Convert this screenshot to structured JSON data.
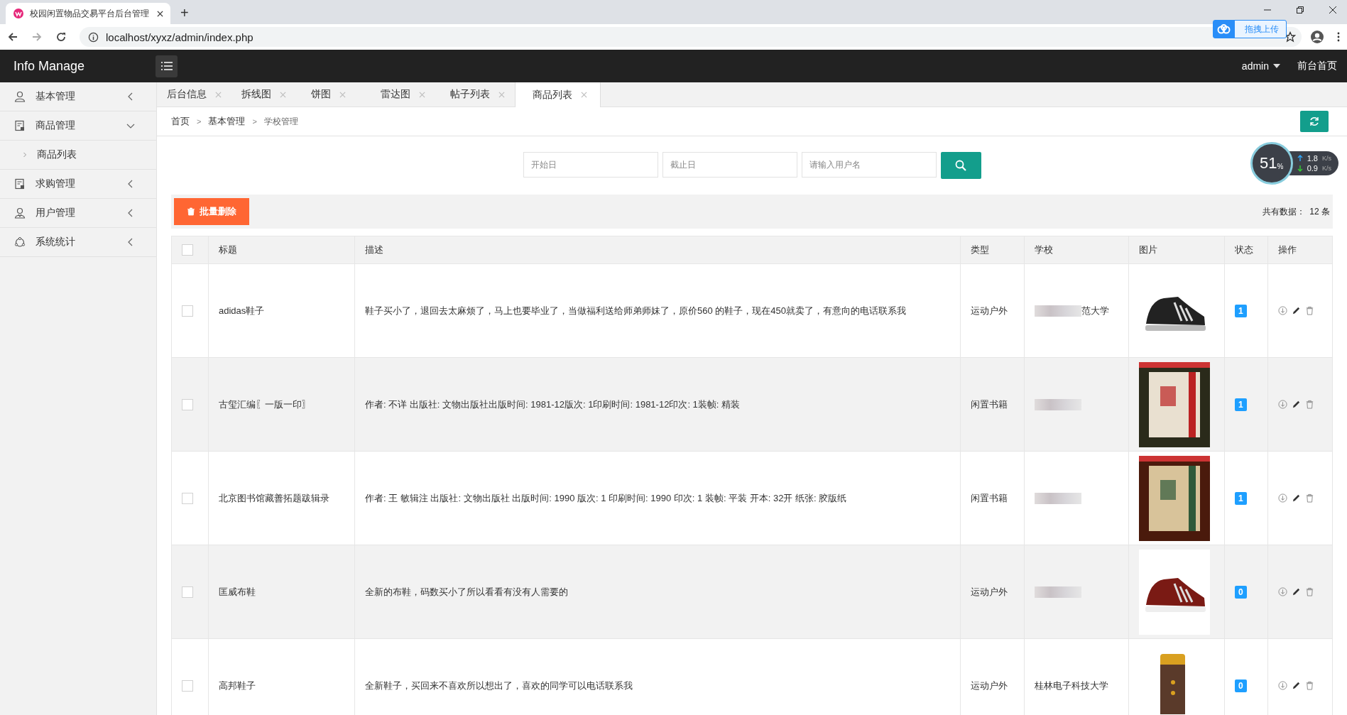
{
  "browser": {
    "tab_title": "校园闲置物品交易平台后台管理",
    "new_tab": "+",
    "url": "localhost/xyxz/admin/index.php"
  },
  "upload_widget": {
    "label": "拖拽上传"
  },
  "net_meter": {
    "percent": "51",
    "unit": "%",
    "up": "1.8",
    "up_unit": "K/s",
    "down": "0.9",
    "down_unit": "K/s"
  },
  "header": {
    "brand": "Info Manage",
    "user": "admin",
    "front_link": "前台首页"
  },
  "sidebar": {
    "items": [
      {
        "label": "基本管理",
        "expanded": false
      },
      {
        "label": "商品管理",
        "expanded": true,
        "children": [
          {
            "label": "商品列表"
          }
        ]
      },
      {
        "label": "求购管理",
        "expanded": false
      },
      {
        "label": "用户管理",
        "expanded": false
      },
      {
        "label": "系统统计",
        "expanded": false
      }
    ]
  },
  "tabs": [
    {
      "label": "后台信息",
      "selected": false
    },
    {
      "label": "拆线图",
      "selected": false
    },
    {
      "label": "饼图",
      "selected": false
    },
    {
      "label": "雷达图",
      "selected": false
    },
    {
      "label": "帖子列表",
      "selected": false
    },
    {
      "label": "商品列表",
      "selected": true
    }
  ],
  "breadcrumb": [
    {
      "label": "首页"
    },
    {
      "separator": ">",
      "label": "基本管理"
    },
    {
      "separator": ">",
      "label": "学校管理"
    }
  ],
  "search": {
    "start_placeholder": "开始日",
    "end_placeholder": "截止日",
    "user_placeholder": "请输入用户名"
  },
  "toolbar": {
    "batch_delete": "批量删除",
    "total_label": "共有数据：",
    "total_count": "12 条"
  },
  "table": {
    "columns": [
      "标题",
      "描述",
      "类型",
      "学校",
      "图片",
      "状态",
      "操作"
    ],
    "header_checked": false,
    "rows": [
      {
        "checked": false,
        "title": "adidas鞋子",
        "description": "鞋子买小了，退回去太麻烦了，马上也要毕业了，当做福利送给师弟师妹了，原价560 的鞋子，现在450就卖了，有意向的电话联系我",
        "type": "运动户外",
        "school": "范大学",
        "school_blurred": true,
        "status": "1"
      },
      {
        "checked": false,
        "title": "古玺汇编〖一版一印〗",
        "description": "作者: 不详 出版社: 文物出版社出版时间: 1981-12版次: 1印刷时间: 1981-12印次: 1装帧: 精装",
        "type": "闲置书籍",
        "school_blurred": true,
        "status": "1"
      },
      {
        "checked": false,
        "title": "北京图书馆藏善拓题跋辑录",
        "description": "作者: 王 敏辑注 出版社: 文物出版社 出版时间: 1990 版次: 1 印刷时间: 1990 印次: 1 装帧: 平装 开本: 32开 纸张: 胶版纸",
        "type": "闲置书籍",
        "school_blurred": true,
        "status": "1"
      },
      {
        "checked": false,
        "title": "匡威布鞋",
        "description": "全新的布鞋，码数买小了所以看看有没有人需要的",
        "type": "运动户外",
        "school_blurred": true,
        "status": "0"
      },
      {
        "checked": false,
        "title": "高邦鞋子",
        "description": "全新鞋子，买回来不喜欢所以想出了，喜欢的同学可以电话联系我",
        "type": "运动户外",
        "school": "桂林电子科技大学",
        "school_blurred": false,
        "status": "0"
      }
    ]
  }
}
